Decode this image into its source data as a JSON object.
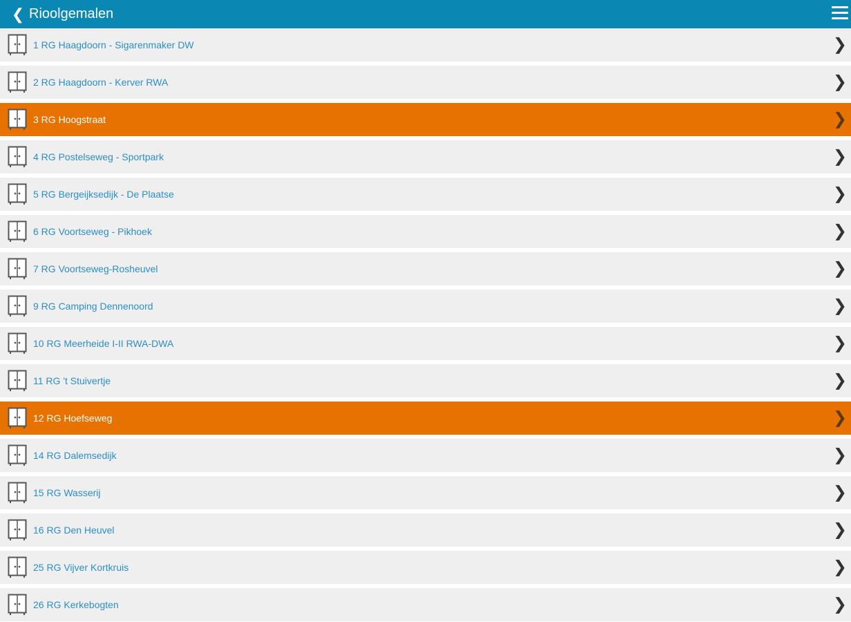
{
  "header": {
    "title": "Rioolgemalen",
    "back_icon": "chevron-left-icon",
    "menu_icon": "hamburger-menu-icon",
    "bg_color": "#0a88b3"
  },
  "list": {
    "item_icon": "cabinet-icon",
    "chevron_icon": "chevron-right-icon",
    "highlight_color": "#e87200",
    "items": [
      {
        "label": "1 RG Haagdoorn - Sigarenmaker DW",
        "highlighted": false
      },
      {
        "label": "2 RG Haagdoorn - Kerver RWA",
        "highlighted": false
      },
      {
        "label": "3 RG Hoogstraat",
        "highlighted": true
      },
      {
        "label": "4 RG Postelseweg - Sportpark",
        "highlighted": false
      },
      {
        "label": "5 RG Bergeijksedijk - De Plaatse",
        "highlighted": false
      },
      {
        "label": "6 RG Voortseweg - Pikhoek",
        "highlighted": false
      },
      {
        "label": "7 RG Voortseweg-Rosheuvel",
        "highlighted": false
      },
      {
        "label": "9 RG Camping Dennenoord",
        "highlighted": false
      },
      {
        "label": "10 RG Meerheide I-II RWA-DWA",
        "highlighted": false
      },
      {
        "label": "11 RG 't Stuivertje",
        "highlighted": false
      },
      {
        "label": "12 RG Hoefseweg",
        "highlighted": true
      },
      {
        "label": "14 RG Dalemsedijk",
        "highlighted": false
      },
      {
        "label": "15 RG Wasserij",
        "highlighted": false
      },
      {
        "label": "16 RG Den Heuvel",
        "highlighted": false
      },
      {
        "label": "25 RG Vijver Kortkruis",
        "highlighted": false
      },
      {
        "label": "26 RG Kerkebogten",
        "highlighted": false
      }
    ]
  }
}
